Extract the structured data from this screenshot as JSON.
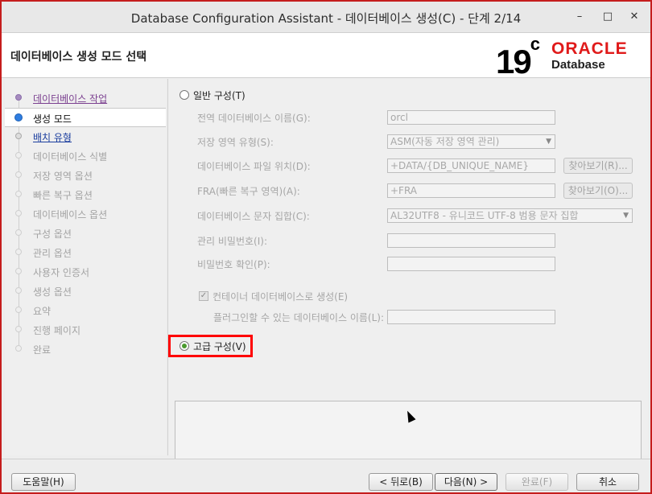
{
  "window": {
    "title": "Database Configuration Assistant - 데이터베이스 생성(C) - 단계 2/14",
    "minimize_glyph": "–",
    "maximize_glyph": "□",
    "close_glyph": "✕"
  },
  "banner": {
    "page_title": "데이터베이스 생성 모드 선택",
    "logo_version": "19",
    "logo_sup": "c",
    "logo_brand": "ORACLE",
    "logo_product": "Database"
  },
  "sidebar": {
    "items": [
      {
        "label": "데이터베이스 작업",
        "state": "visited"
      },
      {
        "label": "생성 모드",
        "state": "current"
      },
      {
        "label": "배치 유형",
        "state": "link"
      },
      {
        "label": "데이터베이스 식별",
        "state": "disabled"
      },
      {
        "label": "저장 영역 옵션",
        "state": "disabled"
      },
      {
        "label": "빠른 복구 옵션",
        "state": "disabled"
      },
      {
        "label": "데이터베이스 옵션",
        "state": "disabled"
      },
      {
        "label": "구성 옵션",
        "state": "disabled"
      },
      {
        "label": "관리 옵션",
        "state": "disabled"
      },
      {
        "label": "사용자 인증서",
        "state": "disabled"
      },
      {
        "label": "생성 옵션",
        "state": "disabled"
      },
      {
        "label": "요약",
        "state": "disabled"
      },
      {
        "label": "진행 페이지",
        "state": "disabled"
      },
      {
        "label": "완료",
        "state": "disabled"
      }
    ]
  },
  "main": {
    "typical_label": "일반 구성(T)",
    "advanced_label": "고급 구성(V)",
    "fields": {
      "global_db_name": {
        "label": "전역 데이터베이스 이름(G):",
        "value": "orcl"
      },
      "storage_type": {
        "label": "저장 영역 유형(S):",
        "value": "ASM(자동 저장 영역 관리)"
      },
      "db_file_location": {
        "label": "데이터베이스 파일 위치(D):",
        "value": "+DATA/{DB_UNIQUE_NAME}"
      },
      "fra": {
        "label": "FRA(빠른 복구 영역)(A):",
        "value": "+FRA"
      },
      "charset": {
        "label": "데이터베이스 문자 집합(C):",
        "value": "AL32UTF8 - 유니코드 UTF-8 범용 문자 집합"
      },
      "admin_password": {
        "label": "관리 비밀번호(I):",
        "value": ""
      },
      "confirm_password": {
        "label": "비밀번호 확인(P):",
        "value": ""
      },
      "pdb_name": {
        "label": "플러그인할 수 있는 데이터베이스 이름(L):",
        "value": ""
      }
    },
    "browse_db_label": "찾아보기(R)...",
    "browse_fra_label": "찾아보기(O)...",
    "container_db_label": "컨테이너 데이터베이스로 생성(E)",
    "container_db_checked": true
  },
  "footer": {
    "help_label": "도움말(H)",
    "back_label": "< 뒤로(B)",
    "next_label": "다음(N) >",
    "finish_label": "완료(F)",
    "cancel_label": "취소"
  },
  "colors": {
    "desktop_bg": "#c51d1d",
    "oracle_red": "#e01a1a",
    "highlight": "#ff0000"
  }
}
